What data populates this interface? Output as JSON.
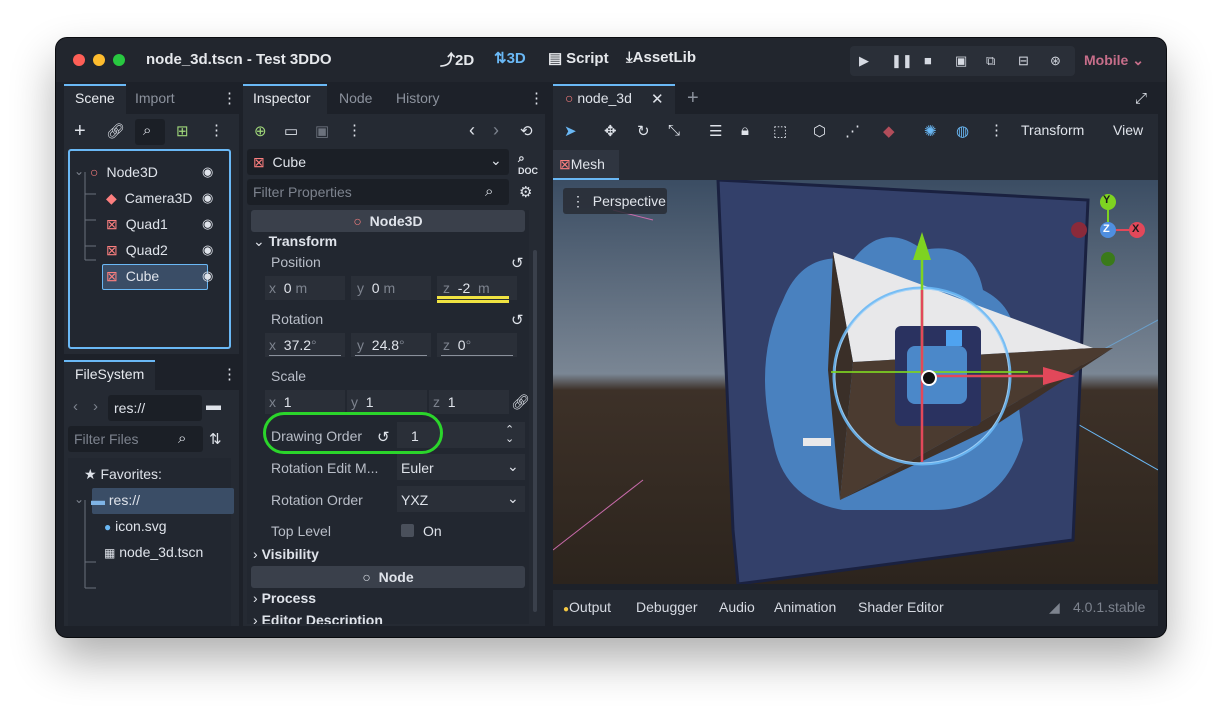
{
  "window": {
    "title": "node_3d.tscn - Test 3DDO",
    "traffic_colors": [
      "#fe5f57",
      "#febc2e",
      "#28c840"
    ]
  },
  "workspaces": [
    {
      "icon": "2d-icon",
      "label": "2D",
      "active": false
    },
    {
      "icon": "3d-icon",
      "label": "3D",
      "active": true
    },
    {
      "icon": "script-icon",
      "label": "Script",
      "active": false
    },
    {
      "icon": "assetlib-icon",
      "label": "AssetLib",
      "active": false
    }
  ],
  "play_controls": [
    "play-icon",
    "pause-icon",
    "stop-icon",
    "remote-debug-icon",
    "play-scene-icon",
    "play-custom-icon",
    "movie-maker-icon"
  ],
  "renderer": "Mobile",
  "scene_dock": {
    "tabs": [
      "Scene",
      "Import"
    ],
    "tree": [
      {
        "name": "Node3D",
        "icon": "node3d-icon",
        "color": "#fc7f7f",
        "depth": 0
      },
      {
        "name": "Camera3D",
        "icon": "camera3d-icon",
        "color": "#fc7f7f",
        "depth": 1
      },
      {
        "name": "Quad1",
        "icon": "mesh-instance-icon",
        "color": "#fc7f7f",
        "depth": 1
      },
      {
        "name": "Quad2",
        "icon": "mesh-instance-icon",
        "color": "#fc7f7f",
        "depth": 1
      },
      {
        "name": "Cube",
        "icon": "mesh-instance-icon",
        "color": "#fc7f7f",
        "depth": 1,
        "selected": true
      }
    ]
  },
  "filesystem_dock": {
    "tab": "FileSystem",
    "path": "res://",
    "filter_placeholder": "Filter Files",
    "favorites_label": "Favorites:",
    "items": [
      {
        "name": "res://",
        "icon": "folder-icon",
        "selected": true
      },
      {
        "name": "icon.svg",
        "icon": "svg-file-icon"
      },
      {
        "name": "node_3d.tscn",
        "icon": "scene-file-icon"
      }
    ]
  },
  "inspector": {
    "tabs": [
      "Inspector",
      "Node",
      "History"
    ],
    "object_name": "Cube",
    "doc_label": "DOC",
    "filter_placeholder": "Filter Properties",
    "class_header": "Node3D",
    "transform_section": "Transform",
    "position": {
      "label": "Position",
      "x": "0",
      "y": "0",
      "z": "-2",
      "unit": "m"
    },
    "rotation": {
      "label": "Rotation",
      "x": "37.2",
      "y": "24.8",
      "z": "0",
      "unit": "°"
    },
    "scale": {
      "label": "Scale",
      "x": "1",
      "y": "1",
      "z": "1"
    },
    "drawing_order": {
      "label": "Drawing Order",
      "value": "1"
    },
    "rotation_edit_mode": {
      "label": "Rotation Edit M...",
      "value": "Euler"
    },
    "rotation_order": {
      "label": "Rotation Order",
      "value": "YXZ"
    },
    "top_level": {
      "label": "Top Level",
      "value": "On"
    },
    "visibility_section": "Visibility",
    "node_header": "Node",
    "process_section": "Process",
    "editor_description_section": "Editor Description"
  },
  "viewport": {
    "tab_label": "node_3d",
    "toolbar_menus": [
      "Transform",
      "View"
    ],
    "mesh_menu": "Mesh",
    "perspective_label": "Perspective",
    "gizmo_axes": {
      "y": "Y",
      "z": "Z",
      "x": "X"
    }
  },
  "bottom_panel": {
    "tabs": [
      "Output",
      "Debugger",
      "Audio",
      "Animation",
      "Shader Editor"
    ],
    "version": "4.0.1.stable"
  },
  "colors": {
    "accent": "#6ab8f5",
    "node3d": "#fc7f7f",
    "highlight_green": "#2bd52b",
    "highlight_yellow": "#f0e341",
    "output_dot": "#f5c842"
  }
}
